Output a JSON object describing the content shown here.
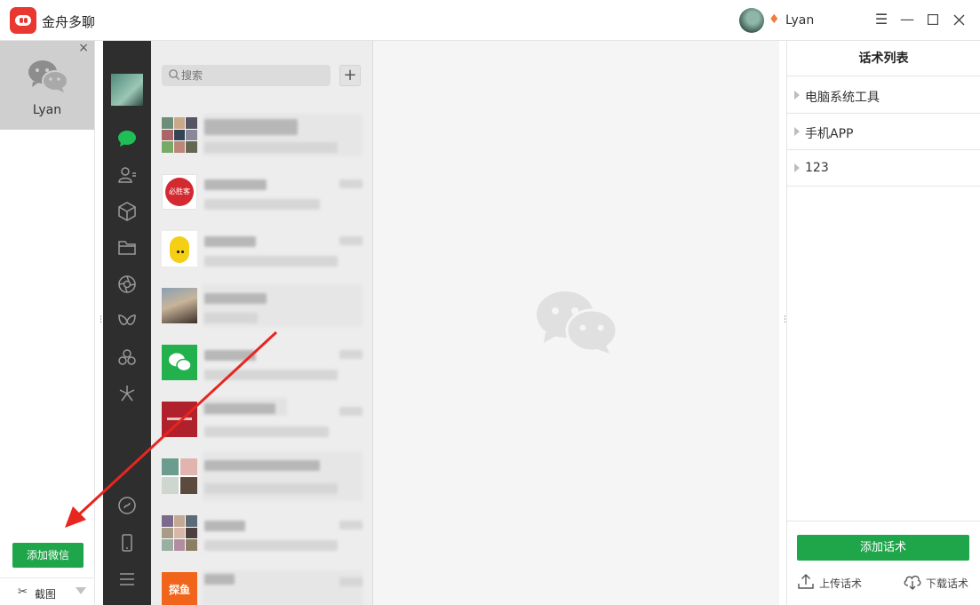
{
  "app": {
    "title": "金舟多聊"
  },
  "user": {
    "name": "Lyan"
  },
  "account_panel": {
    "account_name": "Lyan",
    "add_wechat_label": "添加微信",
    "screenshot_label": "截图"
  },
  "wechat": {
    "search_placeholder": "搜索",
    "add_button": "+",
    "chat_thumbnails": [
      {
        "text": ""
      },
      {
        "text": "必胜客"
      },
      {
        "text": ""
      },
      {
        "text": ""
      },
      {
        "text": ""
      },
      {
        "text": ""
      },
      {
        "text": ""
      },
      {
        "text": ""
      },
      {
        "text": "探鱼"
      }
    ]
  },
  "scripts": {
    "title": "话术列表",
    "items": [
      {
        "label": "电脑系统工具"
      },
      {
        "label": "手机APP"
      },
      {
        "label": "123"
      }
    ],
    "add_label": "添加话术",
    "upload_label": "上传话术",
    "download_label": "下载话术"
  },
  "colors": {
    "brand_red": "#e8382f",
    "wechat_green": "#1fa64a",
    "sidebar_dark": "#2e2e2e",
    "arrow_red": "#e8251f"
  }
}
